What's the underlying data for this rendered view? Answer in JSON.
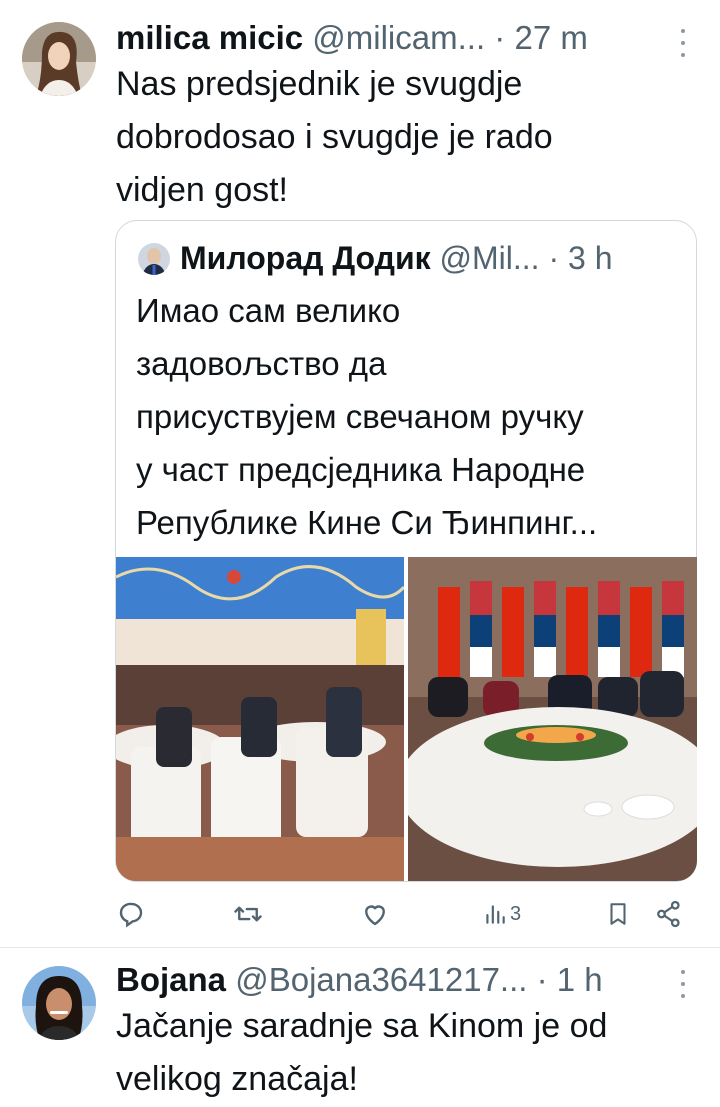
{
  "tweets": [
    {
      "display_name": "milica micic",
      "handle": "@milicam...",
      "separator": "·",
      "time": "27 m",
      "text_lines": [
        "Nas predsjednik je svugdje",
        "dobrodosao i svugdje je rado",
        "vidjen gost!"
      ],
      "quoted": {
        "display_name": "Милорад Додик",
        "handle": "@Mil...",
        "separator": "·",
        "time": "3 h",
        "text_lines": [
          "Имао сам велико",
          "задовољство да",
          "присуствујем свечаном ручку",
          "у част предсједника Народне",
          "Републике Кине Си Ђинпинг..."
        ]
      },
      "actions": {
        "reply_icon": "reply-icon",
        "retweet_icon": "retweet-icon",
        "like_icon": "heart-icon",
        "views_icon": "views-icon",
        "views_count": "3",
        "bookmark_icon": "bookmark-icon",
        "share_icon": "share-icon"
      }
    },
    {
      "display_name": "Bojana",
      "handle": "@Bojana3641217...",
      "separator": "·",
      "time": "1 h",
      "text_lines": [
        "Jačanje saradnje sa Kinom je od",
        "velikog značaja!"
      ]
    }
  ],
  "colors": {
    "text": "#0f1419",
    "secondary": "#536471",
    "border": "#cfd9de"
  }
}
